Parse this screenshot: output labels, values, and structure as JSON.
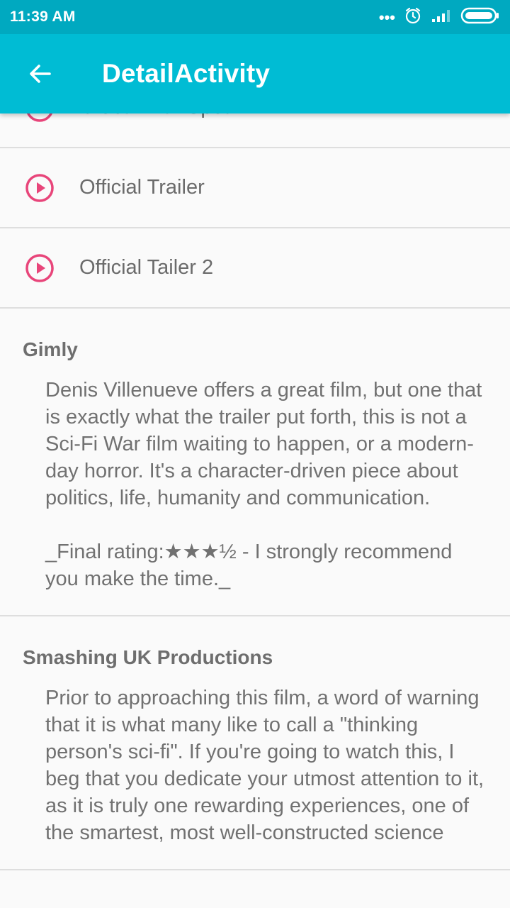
{
  "status_bar": {
    "time": "11:39 AM",
    "icons": [
      "more-dots-icon",
      "alarm-icon",
      "signal-icon",
      "battery-icon"
    ]
  },
  "toolbar": {
    "back_icon": "arrow-back-icon",
    "title": "DetailActivity",
    "color": "#00bcd4",
    "status_color": "#00a9c0"
  },
  "trailers": [
    {
      "label": "Global War Spot",
      "icon": "play-circle-icon"
    },
    {
      "label": "Official Trailer",
      "icon": "play-circle-icon"
    },
    {
      "label": "Official Tailer 2",
      "icon": "play-circle-icon"
    }
  ],
  "reviews": [
    {
      "author": "Gimly",
      "content": "Denis Villenueve offers a great film, but one that is exactly what the trailer put forth, this is not a Sci-Fi War film waiting to happen, or a modern-day horror. It's a character-driven piece about politics, life, humanity and communication.\n\n_Final rating:★★★½ - I strongly recommend you make the time._"
    },
    {
      "author": "Smashing UK Productions",
      "content": "Prior to approaching this film, a word of warning that it is what many like to call a \"thinking person's sci-fi\". If you're going to watch this, I beg that you dedicate your utmost attention to it, as it is truly one rewarding experiences, one of the smartest, most well-constructed science"
    }
  ],
  "accent_color": "#e8457a"
}
